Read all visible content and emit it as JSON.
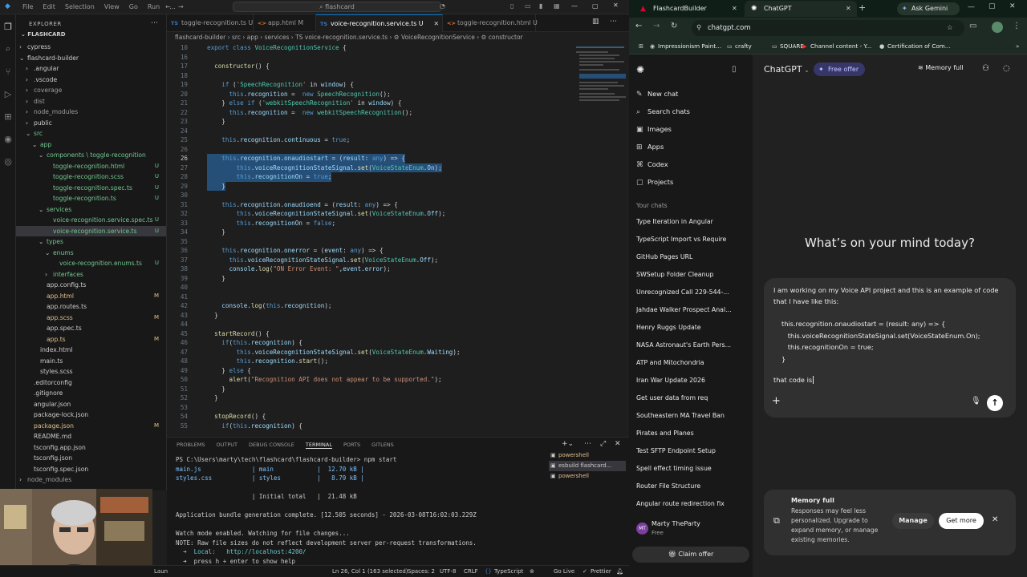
{
  "vscode": {
    "menu": [
      "File",
      "Edit",
      "Selection",
      "View",
      "Go",
      "Run",
      "..."
    ],
    "search_placeholder": "flashcard",
    "explorer_title": "EXPLORER",
    "tree": [
      {
        "name": "cypress",
        "depth": 1,
        "arrow": "›",
        "color": "#cccccc",
        "status": ""
      },
      {
        "name": "flashcard-builder",
        "depth": 1,
        "arrow": "⌄",
        "color": "#cccccc",
        "status": ""
      },
      {
        "name": ".angular",
        "depth": 2,
        "arrow": "›",
        "color": "#cccccc",
        "status": ""
      },
      {
        "name": ".vscode",
        "depth": 2,
        "arrow": "›",
        "color": "#cccccc",
        "status": ""
      },
      {
        "name": "coverage",
        "depth": 2,
        "arrow": "›",
        "color": "#9d9d9d",
        "status": ""
      },
      {
        "name": "dist",
        "depth": 2,
        "arrow": "›",
        "color": "#9d9d9d",
        "status": ""
      },
      {
        "name": "node_modules",
        "depth": 2,
        "arrow": "›",
        "color": "#9d9d9d",
        "status": ""
      },
      {
        "name": "public",
        "depth": 2,
        "arrow": "›",
        "color": "#cccccc",
        "status": ""
      },
      {
        "name": "src",
        "depth": 2,
        "arrow": "⌄",
        "color": "#73c991",
        "status": ""
      },
      {
        "name": "app",
        "depth": 3,
        "arrow": "⌄",
        "color": "#73c991",
        "status": ""
      },
      {
        "name": "components \\ toggle-recognition",
        "depth": 4,
        "arrow": "⌄",
        "color": "#73c991",
        "status": ""
      },
      {
        "name": "toggle-recognition.html",
        "depth": 5,
        "arrow": "",
        "color": "#73c991",
        "status": "U"
      },
      {
        "name": "toggle-recognition.scss",
        "depth": 5,
        "arrow": "",
        "color": "#73c991",
        "status": "U"
      },
      {
        "name": "toggle-recognition.spec.ts",
        "depth": 5,
        "arrow": "",
        "color": "#73c991",
        "status": "U"
      },
      {
        "name": "toggle-recognition.ts",
        "depth": 5,
        "arrow": "",
        "color": "#73c991",
        "status": "U"
      },
      {
        "name": "services",
        "depth": 4,
        "arrow": "⌄",
        "color": "#73c991",
        "status": ""
      },
      {
        "name": "voice-recognition.service.spec.ts",
        "depth": 5,
        "arrow": "",
        "color": "#73c991",
        "status": "U"
      },
      {
        "name": "voice-recognition.service.ts",
        "depth": 5,
        "arrow": "",
        "color": "#73c991",
        "status": "U"
      },
      {
        "name": "types",
        "depth": 4,
        "arrow": "⌄",
        "color": "#73c991",
        "status": ""
      },
      {
        "name": "enums",
        "depth": 5,
        "arrow": "⌄",
        "color": "#73c991",
        "status": ""
      },
      {
        "name": "voice-recognition.enums.ts",
        "depth": 6,
        "arrow": "",
        "color": "#73c991",
        "status": "U"
      },
      {
        "name": "interfaces",
        "depth": 5,
        "arrow": "›",
        "color": "#73c991",
        "status": ""
      },
      {
        "name": "app.config.ts",
        "depth": 4,
        "arrow": "",
        "color": "#cccccc",
        "status": ""
      },
      {
        "name": "app.html",
        "depth": 4,
        "arrow": "",
        "color": "#e2c08d",
        "status": "M"
      },
      {
        "name": "app.routes.ts",
        "depth": 4,
        "arrow": "",
        "color": "#cccccc",
        "status": ""
      },
      {
        "name": "app.scss",
        "depth": 4,
        "arrow": "",
        "color": "#e2c08d",
        "status": "M"
      },
      {
        "name": "app.spec.ts",
        "depth": 4,
        "arrow": "",
        "color": "#cccccc",
        "status": ""
      },
      {
        "name": "app.ts",
        "depth": 4,
        "arrow": "",
        "color": "#e2c08d",
        "status": "M"
      },
      {
        "name": "index.html",
        "depth": 3,
        "arrow": "",
        "color": "#cccccc",
        "status": ""
      },
      {
        "name": "main.ts",
        "depth": 3,
        "arrow": "",
        "color": "#cccccc",
        "status": ""
      },
      {
        "name": "styles.scss",
        "depth": 3,
        "arrow": "",
        "color": "#cccccc",
        "status": ""
      },
      {
        "name": ".editorconfig",
        "depth": 2,
        "arrow": "",
        "color": "#cccccc",
        "status": ""
      },
      {
        "name": ".gitignore",
        "depth": 2,
        "arrow": "",
        "color": "#cccccc",
        "status": ""
      },
      {
        "name": "angular.json",
        "depth": 2,
        "arrow": "",
        "color": "#cccccc",
        "status": ""
      },
      {
        "name": "package-lock.json",
        "depth": 2,
        "arrow": "",
        "color": "#cccccc",
        "status": ""
      },
      {
        "name": "package.json",
        "depth": 2,
        "arrow": "",
        "color": "#e2c08d",
        "status": "M"
      },
      {
        "name": "README.md",
        "depth": 2,
        "arrow": "",
        "color": "#cccccc",
        "status": ""
      },
      {
        "name": "tsconfig.app.json",
        "depth": 2,
        "arrow": "",
        "color": "#cccccc",
        "status": ""
      },
      {
        "name": "tsconfig.json",
        "depth": 2,
        "arrow": "",
        "color": "#cccccc",
        "status": ""
      },
      {
        "name": "tsconfig.spec.json",
        "depth": 2,
        "arrow": "",
        "color": "#cccccc",
        "status": ""
      },
      {
        "name": "node_modules",
        "depth": 1,
        "arrow": "›",
        "color": "#9d9d9d",
        "status": ""
      }
    ],
    "tabs": [
      {
        "label": "toggle-recognition.ts U",
        "icon": "TS",
        "active": false
      },
      {
        "label": "app.html M",
        "icon": "<>",
        "active": false
      },
      {
        "label": "voice-recognition.service.ts U",
        "icon": "TS",
        "active": true
      },
      {
        "label": "toggle-recognition.html U",
        "icon": "<>",
        "active": false
      }
    ],
    "breadcrumb": "flashcard-builder › src › app › services › TS voice-recognition.service.ts › ⚙ VoiceRecognitionService › ⚙ constructor",
    "code": [
      {
        "n": "10",
        "t": "export class VoiceRecognitionService {",
        "hl": false
      },
      {
        "n": "16",
        "t": "",
        "hl": false
      },
      {
        "n": "17",
        "t": "  constructor() {",
        "hl": false
      },
      {
        "n": "18",
        "t": "",
        "hl": false
      },
      {
        "n": "19",
        "t": "    if ('SpeechRecognition' in window) {",
        "hl": false
      },
      {
        "n": "20",
        "t": "      this.recognition =  new SpeechRecognition();",
        "hl": false
      },
      {
        "n": "21",
        "t": "    } else if ('webkitSpeechRecognition' in window) {",
        "hl": false
      },
      {
        "n": "22",
        "t": "      this.recognition =  new webkitSpeechRecognition();",
        "hl": false
      },
      {
        "n": "23",
        "t": "    }",
        "hl": false
      },
      {
        "n": "24",
        "t": "",
        "hl": false
      },
      {
        "n": "25",
        "t": "    this.recognition.continuous = true;",
        "hl": false
      },
      {
        "n": "26",
        "t": "",
        "hl": false
      },
      {
        "n": "26",
        "t": "    this.recognition.onaudiostart = (result: any) => {",
        "hl": true
      },
      {
        "n": "27",
        "t": "        this.voiceRecognitionStateSignal.set(VoiceStateEnum.On);",
        "hl": true
      },
      {
        "n": "28",
        "t": "        this.recognitionOn = true;",
        "hl": true
      },
      {
        "n": "29",
        "t": "    }",
        "hl": true
      },
      {
        "n": "30",
        "t": "",
        "hl": false
      },
      {
        "n": "31",
        "t": "    this.recognition.onaudioend = (result: any) => {",
        "hl": false
      },
      {
        "n": "32",
        "t": "        this.voiceRecognitionStateSignal.set(VoiceStateEnum.Off);",
        "hl": false
      },
      {
        "n": "33",
        "t": "        this.recognitionOn = false;",
        "hl": false
      },
      {
        "n": "34",
        "t": "    }",
        "hl": false
      },
      {
        "n": "35",
        "t": "",
        "hl": false
      },
      {
        "n": "36",
        "t": "    this.recognition.onerror = (event: any) => {",
        "hl": false
      },
      {
        "n": "37",
        "t": "      this.voiceRecognitionStateSignal.set(VoiceStateEnum.Off);",
        "hl": false
      },
      {
        "n": "38",
        "t": "      console.log(\"ON Error Event: \",event.error);",
        "hl": false
      },
      {
        "n": "39",
        "t": "    }",
        "hl": false
      },
      {
        "n": "40",
        "t": "",
        "hl": false
      },
      {
        "n": "41",
        "t": "",
        "hl": false
      },
      {
        "n": "42",
        "t": "    console.log(this.recognition);",
        "hl": false
      },
      {
        "n": "43",
        "t": "  }",
        "hl": false
      },
      {
        "n": "44",
        "t": "",
        "hl": false
      },
      {
        "n": "45",
        "t": "  startRecord() {",
        "hl": false
      },
      {
        "n": "46",
        "t": "    if(this.recognition) {",
        "hl": false
      },
      {
        "n": "47",
        "t": "        this.voiceRecognitionStateSignal.set(VoiceStateEnum.Waiting);",
        "hl": false
      },
      {
        "n": "48",
        "t": "        this.recognition.start();",
        "hl": false
      },
      {
        "n": "49",
        "t": "    } else {",
        "hl": false
      },
      {
        "n": "50",
        "t": "      alert(\"Recognition API does not appear to be supported.\");",
        "hl": false
      },
      {
        "n": "51",
        "t": "    }",
        "hl": false
      },
      {
        "n": "52",
        "t": "  }",
        "hl": false
      },
      {
        "n": "53",
        "t": "",
        "hl": false
      },
      {
        "n": "54",
        "t": "  stopRecord() {",
        "hl": false
      },
      {
        "n": "55",
        "t": "    if(this.recognition) {",
        "hl": false
      }
    ],
    "panel_tabs": [
      "PROBLEMS",
      "OUTPUT",
      "DEBUG CONSOLE",
      "TERMINAL",
      "PORTS",
      "GITLENS"
    ],
    "terminal": [
      "PS C:\\Users\\marty\\tech\\flashcard\\flashcard-builder> npm start",
      "main.js              | main            |  12.70 kB |",
      "styles.css           | styles          |   8.79 kB |",
      "",
      "                     | Initial total   |  21.48 kB",
      "",
      "Application bundle generation complete. [12.505 seconds] - 2026-03-08T16:02:03.229Z",
      "",
      "Watch mode enabled. Watching for file changes...",
      "NOTE: Raw file sizes do not reflect development server per-request transformations.",
      "  ➜  Local:   http://localhost:4200/",
      "  ➜  press h + enter to show help",
      ""
    ],
    "terminal_list": [
      "powershell",
      "esbuild flashcard...",
      "powershell"
    ],
    "status": {
      "position": "Ln 26, Col 1 (163 selected)",
      "spaces": "Spaces: 2",
      "encoding": "UTF-8",
      "eol": "CRLF",
      "lang": "TypeScript",
      "golive": "Go Live",
      "prettier": "Prettier",
      "launch": "Laun"
    }
  },
  "chrome": {
    "tabs": [
      {
        "label": "FlashcardBuilder"
      },
      {
        "label": "ChatGPT"
      }
    ],
    "gemini": "Ask Gemini",
    "url": "chatgpt.com",
    "bookmarks": [
      "Impressionism Paint...",
      "crafty",
      "SQUARE",
      "Channel content - Y...",
      "Certification of Com..."
    ]
  },
  "chatgpt": {
    "model": "ChatGPT",
    "free_offer": "Free offer",
    "memory_full_badge": "Memory full",
    "nav": [
      {
        "label": "New chat",
        "icon": "✎"
      },
      {
        "label": "Search chats",
        "icon": "⌕"
      },
      {
        "label": "Images",
        "icon": "▣"
      },
      {
        "label": "Apps",
        "icon": "⊞"
      },
      {
        "label": "Codex",
        "icon": "⌘"
      },
      {
        "label": "Projects",
        "icon": "▢"
      }
    ],
    "your_chats": "Your chats",
    "chats": [
      "Type Iteration in Angular",
      "TypeScript Import vs Require",
      "GitHub Pages URL",
      "SWSetup Folder Cleanup",
      "Unrecognized Call 229-544-...",
      "Jahdae Walker Prospect Anal...",
      "Henry Ruggs Update",
      "NASA Astronaut's Earth Pers...",
      "ATP and Mitochondria",
      "Iran War Update 2026",
      "Get user data from req",
      "Southeastern MA Travel Ban",
      "Pirates and Planes",
      "Test SFTP Endpoint Setup",
      "Spell effect timing issue",
      "Router File Structure",
      "Angular route redirection fix"
    ],
    "user": {
      "name": "Marty TheParty",
      "plan": "Free",
      "initials": "MT"
    },
    "claim_offer": "Claim offer",
    "heading": "What’s on your mind today?",
    "prompt": {
      "intro": "I am working on my Voice API project and this is an example of code that I have like this:",
      "code": [
        "this.recognition.onaudiostart = (result: any) => {",
        "   this.voiceRecognitionStateSignal.set(VoiceStateEnum.On);",
        "   this.recognitionOn = true;",
        "}"
      ],
      "tail": "that code is"
    },
    "memory": {
      "title": "Memory full",
      "body": "Responses may feel less personalized. Upgrade to expand memory, or manage existing memories.",
      "manage": "Manage",
      "get_more": "Get more"
    }
  }
}
